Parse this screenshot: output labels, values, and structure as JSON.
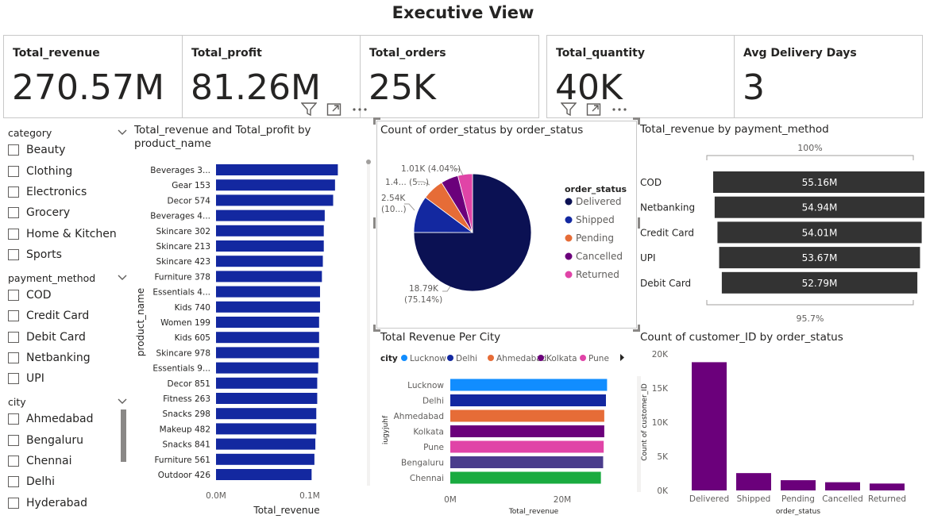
{
  "page": {
    "title": "Executive View"
  },
  "kpis": [
    {
      "label": "Total_revenue",
      "value": "270.57M"
    },
    {
      "label": "Total_profit",
      "value": "81.26M"
    },
    {
      "label": "Total_orders",
      "value": "25K"
    },
    {
      "label": "Total_quantity",
      "value": "40K"
    },
    {
      "label": "Avg Delivery Days",
      "value": "3"
    }
  ],
  "slicers": {
    "category": {
      "header": "category",
      "items": [
        "Beauty",
        "Clothing",
        "Electronics",
        "Grocery",
        "Home & Kitchen",
        "Sports"
      ]
    },
    "payment_method": {
      "header": "payment_method",
      "items": [
        "COD",
        "Credit Card",
        "Debit Card",
        "Netbanking",
        "UPI"
      ]
    },
    "city": {
      "header": "city",
      "items": [
        "Ahmedabad",
        "Bengaluru",
        "Chennai",
        "Delhi",
        "Hyderabad"
      ]
    }
  },
  "icons": {
    "filter": "filter-icon",
    "focus": "focus-mode-icon",
    "more": "more-options-icon",
    "chevron": "chevron-down-icon",
    "next": "legend-next-icon"
  },
  "colors": {
    "navy": "#1328a0",
    "darkNavy": "#0b1153",
    "orange": "#e66c37",
    "purple": "#6b007b",
    "pink": "#e044a7",
    "lightBlue": "#118dff",
    "violet": "#4a3c8c",
    "green": "#1aab40",
    "funnel": "#333333"
  },
  "chart_data": [
    {
      "type": "bar",
      "orientation": "horizontal",
      "title": "Total_revenue and Total_profit by product_name",
      "xlabel": "Total_revenue",
      "ylabel": "product_name",
      "xlim": [
        0,
        0.15
      ],
      "xticks": [
        "0.0M",
        "0.1M"
      ],
      "categories": [
        "Beverages 3...",
        "Gear 153",
        "Decor 574",
        "Beverages 4...",
        "Skincare 302",
        "Skincare 213",
        "Skincare 423",
        "Furniture 378",
        "Essentials 4...",
        "Kids 740",
        "Women 199",
        "Kids 605",
        "Skincare 978",
        "Essentials 9...",
        "Decor 851",
        "Fitness 263",
        "Snacks 298",
        "Makeup 482",
        "Snacks 841",
        "Furniture 561",
        "Outdoor 426"
      ],
      "values": [
        0.13,
        0.127,
        0.125,
        0.116,
        0.115,
        0.115,
        0.114,
        0.113,
        0.111,
        0.111,
        0.11,
        0.11,
        0.11,
        0.109,
        0.108,
        0.108,
        0.107,
        0.107,
        0.106,
        0.105,
        0.102
      ],
      "color": "#1328a0"
    },
    {
      "type": "pie",
      "title": "Count of order_status by order_status",
      "legend_title": "order_status",
      "legend_position": "right",
      "labels": [
        "Delivered",
        "Shipped",
        "Pending",
        "Cancelled",
        "Returned"
      ],
      "values": [
        18790,
        2540,
        1500,
        1200,
        1010
      ],
      "colors": [
        "#0b1153",
        "#1328a0",
        "#e66c37",
        "#6b007b",
        "#e044a7"
      ],
      "data_labels": [
        {
          "value": "18.79K",
          "pct": "(75.14%)"
        },
        {
          "value": "2.54K",
          "pct": "(10...)"
        },
        {
          "value": "1.4...",
          "pct": "(5...)"
        },
        {
          "value": "1.01K (4.04%)",
          "pct": ""
        }
      ]
    },
    {
      "type": "bar",
      "subtype": "funnel",
      "title": "Total_revenue by payment_method",
      "top_label": "100%",
      "bottom_label": "95.7%",
      "categories": [
        "COD",
        "Netbanking",
        "Credit Card",
        "UPI",
        "Debit Card"
      ],
      "values": [
        55.16,
        54.94,
        54.01,
        53.67,
        52.79
      ],
      "value_labels": [
        "55.16M",
        "54.94M",
        "54.01M",
        "53.67M",
        "52.79M"
      ]
    },
    {
      "type": "bar",
      "orientation": "horizontal",
      "title": "Total Revenue Per City",
      "legend_title": "city",
      "legend_position": "top-left",
      "legend": [
        "Lucknow",
        "Delhi",
        "Ahmedabad",
        "Kolkata",
        "Pune"
      ],
      "xlabel": "Total_revenue",
      "ylabel": "iugyjuhf",
      "xlim": [
        0,
        30
      ],
      "xticks": [
        "0M",
        "20M"
      ],
      "categories": [
        "Lucknow",
        "Delhi",
        "Ahmedabad",
        "Kolkata",
        "Pune",
        "Bengaluru",
        "Chennai"
      ],
      "values": [
        28.0,
        27.8,
        27.5,
        27.5,
        27.4,
        27.3,
        26.9
      ],
      "colors": [
        "#118dff",
        "#1328a0",
        "#e66c37",
        "#6b007b",
        "#e044a7",
        "#4a3c8c",
        "#1aab40"
      ]
    },
    {
      "type": "bar",
      "title": "Count of customer_ID by order_status",
      "xlabel": "order_status",
      "ylabel": "Count of customer_ID",
      "ylim": [
        0,
        20000
      ],
      "yticks": [
        "0K",
        "5K",
        "10K",
        "15K",
        "20K"
      ],
      "categories": [
        "Delivered",
        "Shipped",
        "Pending",
        "Cancelled",
        "Returned"
      ],
      "values": [
        18790,
        2540,
        1500,
        1200,
        1010
      ],
      "color": "#6b007b"
    }
  ]
}
